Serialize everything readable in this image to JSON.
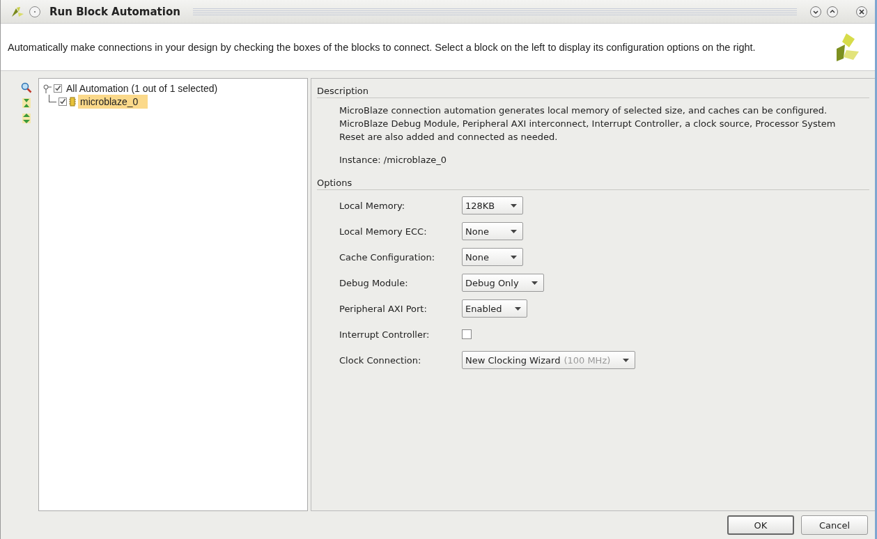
{
  "window": {
    "title": "Run Block Automation"
  },
  "header": {
    "text": "Automatically make connections in your design by checking the boxes of the blocks to connect. Select a block on the left to display its configuration options on the right."
  },
  "tree": {
    "label": "All Automation (1 out of 1 selected)",
    "checked": true,
    "expanded": true,
    "children": [
      {
        "label": "microblaze_0",
        "checked": true,
        "selected": true
      }
    ]
  },
  "description": {
    "heading": "Description",
    "text": "MicroBlaze connection automation generates local memory of selected size, and caches can be configured. MicroBlaze Debug Module, Peripheral AXI interconnect, Interrupt Controller, a clock source, Processor System Reset are also added and connected as needed.",
    "instance": "Instance: /microblaze_0"
  },
  "options": {
    "heading": "Options",
    "rows": [
      {
        "kind": "dropdown",
        "label": "Local Memory:",
        "value": "128KB"
      },
      {
        "kind": "dropdown",
        "label": "Local Memory ECC:",
        "value": "None"
      },
      {
        "kind": "dropdown",
        "label": "Cache Configuration:",
        "value": "None"
      },
      {
        "kind": "dropdown",
        "label": "Debug Module:",
        "value": "Debug Only"
      },
      {
        "kind": "dropdown",
        "label": "Peripheral AXI Port:",
        "value": "Enabled"
      },
      {
        "kind": "checkbox",
        "label": "Interrupt Controller:",
        "checked": false
      },
      {
        "kind": "dropdown",
        "label": "Clock Connection:",
        "value": "New Clocking Wizard",
        "hint": "(100 MHz)"
      }
    ]
  },
  "buttons": [
    "OK",
    "Cancel"
  ]
}
